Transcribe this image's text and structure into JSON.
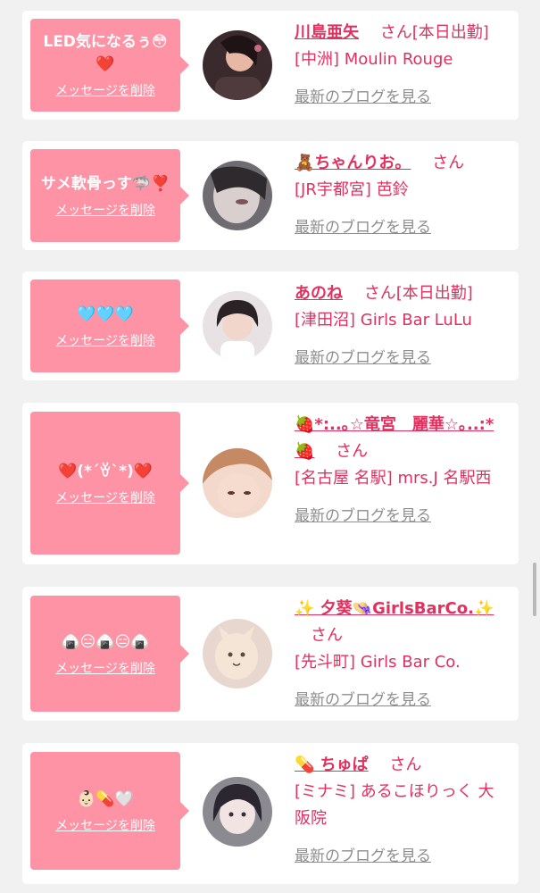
{
  "delete_label": "メッセージを削除",
  "blog_label": "最新のブログを見る",
  "honorific": "さん",
  "colors": {
    "page_bg": "#f2f1f1",
    "card_bg": "#ffffff",
    "bubble_bg": "#ff93a6",
    "name_color": "#e2305f",
    "link_gray": "#8e8e8e"
  },
  "cards": [
    {
      "message": "LED気になるぅ😳❤️",
      "name": "川島亜矢",
      "status": "[本日出勤]",
      "shop": "[中洲] Moulin Rouge",
      "avatar_icon": "profile-photo-1"
    },
    {
      "message": "サメ軟骨っす🦈❣️",
      "name": "🧸ちゃんりお。",
      "status": "",
      "shop": "[JR宇都宮] 芭鈴",
      "avatar_icon": "profile-photo-2"
    },
    {
      "message": "🩵🩵🩵",
      "name": "あのね",
      "status": "[本日出勤]",
      "shop": "[津田沼] Girls Bar LuLu",
      "avatar_icon": "profile-photo-3"
    },
    {
      "message": "❤️(*´ꈊ`*)❤️",
      "name": "🍓*:..｡☆竜宮　麗華☆｡..:*🍓",
      "status": "",
      "shop": "[名古屋 名駅] mrs.J 名駅西",
      "avatar_icon": "profile-photo-4"
    },
    {
      "message": "🍙😑🍙😑🍙",
      "name": "✨ 夕葵👒GirlsBarCo.✨",
      "status": "",
      "shop": "[先斗町] Girls Bar Co.",
      "avatar_icon": "profile-photo-5"
    },
    {
      "message": "👶🏻💊🤍",
      "name": "💊 ちゅぱ",
      "status": "",
      "shop": "[ミナミ] あるこほりっく 大阪院",
      "avatar_icon": "profile-photo-6"
    }
  ]
}
